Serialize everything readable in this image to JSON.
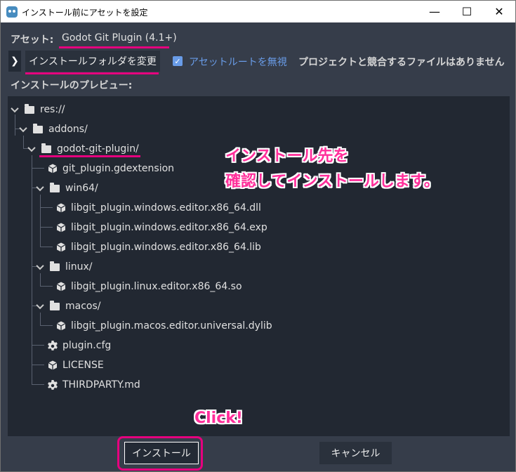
{
  "window": {
    "title": "インストール前にアセットを設定",
    "minimize_glyph": "—",
    "maximize_glyph": "☐",
    "close_glyph": "✕"
  },
  "asset": {
    "label": "アセット:",
    "name": "Godot Git Plugin (4.1+)"
  },
  "toolbar": {
    "expand_glyph": "❯",
    "change_folder_label": "インストールフォルダを変更",
    "ignore_root_label": "アセットルートを無視",
    "ignore_root_checked": true,
    "checkbox_glyph": "✓",
    "no_conflict_text": "プロジェクトと競合するファイルはありません"
  },
  "preview": {
    "label": "インストールのプレビュー:",
    "tree": [
      {
        "name": "res://",
        "kind": "folder",
        "icon": "folder-icon"
      },
      {
        "name": "addons/",
        "kind": "folder",
        "icon": "folder-icon"
      },
      {
        "name": "godot-git-plugin/",
        "kind": "folder",
        "icon": "folder-icon"
      },
      {
        "name": "git_plugin.gdextension",
        "kind": "file",
        "icon": "gdextension-icon"
      },
      {
        "name": "win64/",
        "kind": "folder",
        "icon": "folder-icon"
      },
      {
        "name": "libgit_plugin.windows.editor.x86_64.dll",
        "kind": "file",
        "icon": "gdextension-icon"
      },
      {
        "name": "libgit_plugin.windows.editor.x86_64.exp",
        "kind": "file",
        "icon": "gdextension-icon"
      },
      {
        "name": "libgit_plugin.windows.editor.x86_64.lib",
        "kind": "file",
        "icon": "gdextension-icon"
      },
      {
        "name": "linux/",
        "kind": "folder",
        "icon": "folder-icon"
      },
      {
        "name": "libgit_plugin.linux.editor.x86_64.so",
        "kind": "file",
        "icon": "gdextension-icon"
      },
      {
        "name": "macos/",
        "kind": "folder",
        "icon": "folder-icon"
      },
      {
        "name": "libgit_plugin.macos.editor.universal.dylib",
        "kind": "file",
        "icon": "gdextension-icon"
      },
      {
        "name": "plugin.cfg",
        "kind": "file",
        "icon": "gear-icon"
      },
      {
        "name": "LICENSE",
        "kind": "file",
        "icon": "gdextension-icon"
      },
      {
        "name": "THIRDPARTY.md",
        "kind": "file",
        "icon": "gear-icon"
      }
    ]
  },
  "annotations": {
    "line1": "インストール先を",
    "line2": "確認してインストールします。",
    "click": "Click!"
  },
  "buttons": {
    "install_label": "インストール",
    "cancel_label": "キャンセル"
  },
  "colors": {
    "accent": "#699ce8",
    "highlight": "#e5007e",
    "annotation_text": "#ff2e9a",
    "panel_bg": "#363d4a",
    "tree_bg": "#222832"
  }
}
